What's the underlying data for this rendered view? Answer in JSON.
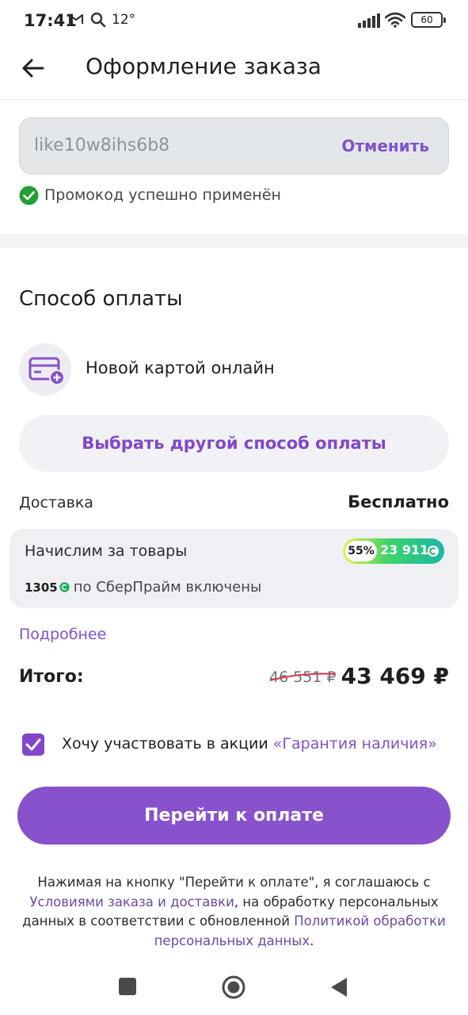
{
  "status_bar": {
    "time": "17:41",
    "temperature": "12°",
    "battery": "60"
  },
  "header": {
    "title": "Оформление заказа"
  },
  "promo": {
    "code": "like10w8ihs6b8",
    "cancel_label": "Отменить",
    "status_text": "Промокод успешно применён"
  },
  "payment": {
    "title": "Способ оплаты",
    "method_label": "Новой картой онлайн",
    "other_method_button": "Выбрать другой способ оплаты"
  },
  "delivery": {
    "label": "Доставка",
    "value": "Бесплатно"
  },
  "bonus": {
    "title": "Начислим за товары",
    "percent": "55%",
    "amount": "23 911",
    "prime_amount": "1305",
    "prime_text": "по СберПрайм включены"
  },
  "more_link": "Подробнее",
  "total": {
    "label": "Итого:",
    "old_price": "46 551 ₽",
    "new_price": "43 469 ₽"
  },
  "guarantee": {
    "text": "Хочу участвовать в акции",
    "link": "«Гарантия наличия»",
    "checked": true
  },
  "pay_button": "Перейти к оплате",
  "legal": {
    "part1": "Нажимая на кнопку \"Перейти к оплате\", я соглашаюсь с",
    "link1": "Условиями заказа и доставки",
    "part2": ", на обработку персональных данных в соответствии с обновленной",
    "link2": "Политикой обработки персональных данных",
    "part3": "."
  },
  "colors": {
    "accent": "#8752cc",
    "link": "#7f52c9",
    "success": "#21a038"
  }
}
